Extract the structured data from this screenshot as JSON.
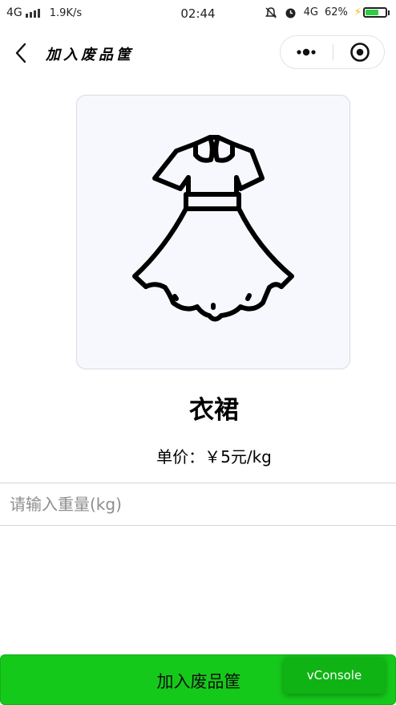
{
  "status_bar": {
    "network": "4G",
    "speed": "1.9K/s",
    "time": "02:44",
    "network_right": "4G",
    "battery": "62%",
    "icons": [
      "signal-icon",
      "mute-icon",
      "alarm-icon",
      "battery-icon",
      "charging-icon"
    ]
  },
  "nav": {
    "title": "加入废品筐",
    "back_icon": "chevron-left-icon",
    "more_icon": "more-dots-icon",
    "close_icon": "target-close-icon"
  },
  "item": {
    "image_icon": "dress-icon",
    "name": "衣裙",
    "price": "单价：￥5元/kg"
  },
  "weight_input": {
    "placeholder": "请输入重量(kg)",
    "value": ""
  },
  "submit": {
    "label": "加入废品筐"
  },
  "vconsole": {
    "label": "vConsole"
  },
  "colors": {
    "primary_green": "#15c91a",
    "card_background": "#f7f8fe",
    "battery_green": "#2ecc40"
  }
}
